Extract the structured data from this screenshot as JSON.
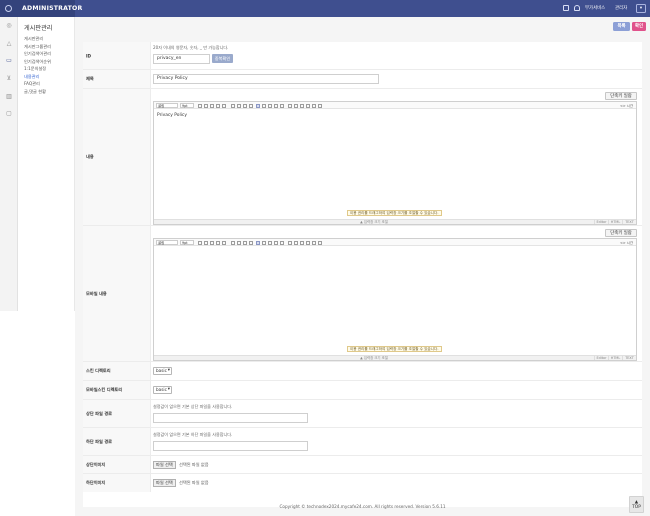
{
  "header": {
    "brand": "ADMINISTRATOR",
    "service_link": "부가서비스",
    "admin_select": "관리자",
    "brand_color": "#3f4f8f"
  },
  "iconbar": {
    "icons": [
      "dashboard-icon",
      "bell-icon",
      "board-icon",
      "cart-icon",
      "chart-icon",
      "chat-icon"
    ]
  },
  "submenu": {
    "title": "게시판관리",
    "items": [
      {
        "label": "게시판관리",
        "active": false
      },
      {
        "label": "게시판그룹관리",
        "active": false
      },
      {
        "label": "인기검색어관리",
        "active": false
      },
      {
        "label": "인기검색어순위",
        "active": false
      },
      {
        "label": "1:1문의설정",
        "active": false
      },
      {
        "label": "내용관리",
        "active": true
      },
      {
        "label": "FAQ관리",
        "active": false
      },
      {
        "label": "글,댓글 현황",
        "active": false
      }
    ]
  },
  "actions": {
    "list_label": "목록",
    "confirm_label": "확인"
  },
  "form": {
    "id": {
      "label": "ID",
      "hint": "20자 이내의 영문자, 숫자, _ 만 가능합니다.",
      "value": "privacy_en",
      "dup_label": "중복확인"
    },
    "title": {
      "label": "제목",
      "value": "Privacy Policy"
    },
    "content": {
      "label": "내용",
      "shortcut_label": "단축키 일람",
      "toolbar_font": "굴림",
      "toolbar_size": "9pt",
      "toolbar_source": "<> 시간",
      "body": "Privacy Policy",
      "tip": "이용 권리를 드래그하여 입력창 크기를 조절할 수 있습니다.",
      "resize_label": "▲ 입력창 크기 조절",
      "mode_tabs": [
        "Editor",
        "HTML",
        "TEXT"
      ]
    },
    "mobile_content": {
      "label": "모바일 내용",
      "shortcut_label": "단축키 일람",
      "toolbar_font": "굴림",
      "toolbar_size": "9pt",
      "toolbar_source": "<> 시간",
      "body": "",
      "tip": "이용 권리를 드래그하여 입력창 크기를 조절할 수 있습니다.",
      "resize_label": "▲ 입력창 크기 조절",
      "mode_tabs": [
        "Editor",
        "HTML",
        "TEXT"
      ]
    },
    "skin_dir": {
      "label": "스킨 디렉토리",
      "value": "basic"
    },
    "mobile_skin_dir": {
      "label": "모바일스킨 디렉토리",
      "value": "basic"
    },
    "header_file": {
      "label": "상단 파일 경로",
      "hint": "설정값이 없으면 기본 상단 파일을 사용합니다."
    },
    "footer_file": {
      "label": "하단 파일 경로",
      "hint": "설정값이 없으면 기본 하단 파일을 사용합니다."
    },
    "header_image": {
      "label": "상단이미지",
      "button": "파일 선택",
      "status": "선택된 파일 없음"
    },
    "footer_image": {
      "label": "하단이미지",
      "button": "파일 선택",
      "status": "선택된 파일 없음"
    }
  },
  "footer": {
    "copyright": "Copyright © technodex2024.mycafe24.com. All rights reserved. Version 5.6.11",
    "top_label": "TOP"
  }
}
